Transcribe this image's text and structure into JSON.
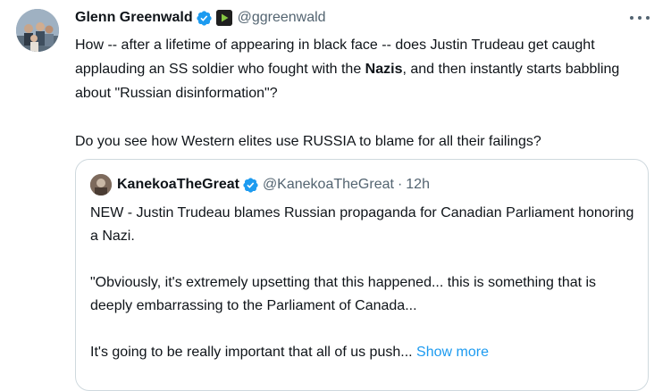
{
  "tweet": {
    "author_name": "Glenn Greenwald",
    "author_handle": "@ggreenwald",
    "paragraph1_before": "How -- after a lifetime of appearing in black face -- does Justin Trudeau get caught applauding an SS soldier who fought with the ",
    "paragraph1_bold": "Nazis",
    "paragraph1_after": ", and then instantly starts babbling about \"Russian disinformation\"?",
    "paragraph2": "Do you see how Western elites use RUSSIA to blame for all their failings?"
  },
  "quote": {
    "author_name": "KanekoaTheGreat",
    "author_handle": "@KanekoaTheGreat",
    "separator": "·",
    "time": "12h",
    "paragraph1": "NEW - Justin Trudeau blames Russian propaganda for Canadian Parliament honoring a Nazi.",
    "paragraph2": "\"Obviously, it's extremely upsetting that this happened... this is something that is deeply embarrassing to the Parliament of Canada...",
    "paragraph3": "It's going to be really important that all of us push...",
    "show_more": "Show more"
  },
  "colors": {
    "verified": "#1d9bf0",
    "link": "#1d9bf0",
    "secondary_text": "#536471",
    "border": "#cfd9de"
  },
  "icons": {
    "verified": "verified-badge-icon",
    "affiliate": "rumble-affiliate-icon",
    "more": "more-options-icon"
  }
}
